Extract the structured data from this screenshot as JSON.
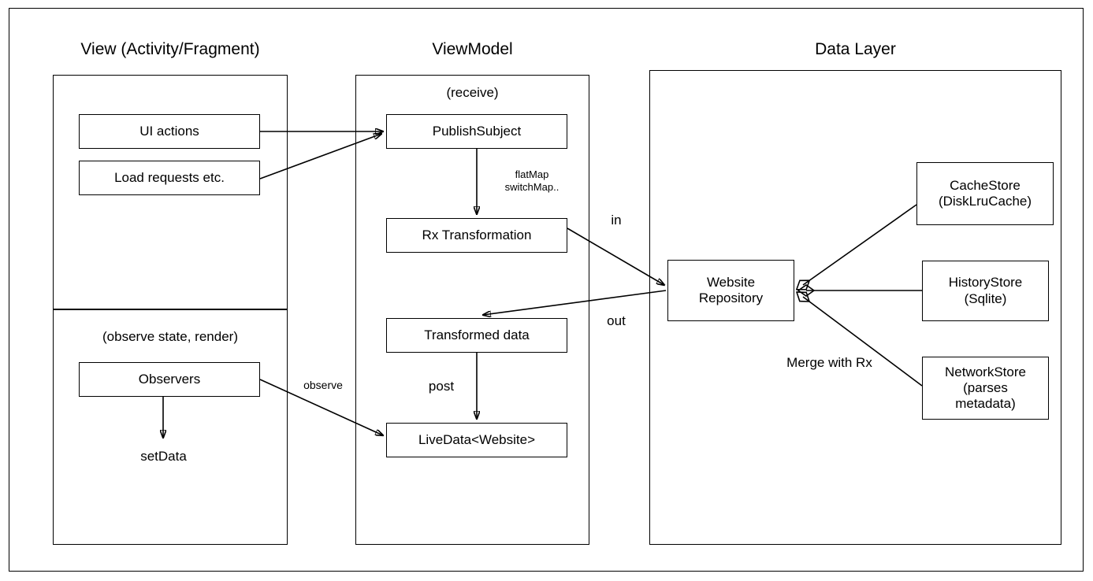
{
  "diagram": {
    "title_view": "View (Activity/Fragment)",
    "title_viewmodel": "ViewModel",
    "title_datalayer": "Data Layer"
  },
  "view_column": {
    "upper": {
      "nodes": [
        {
          "label": "UI actions"
        },
        {
          "label": "Load requests etc."
        }
      ]
    },
    "lower": {
      "caption": "(observe state, render)",
      "nodes": [
        {
          "label": "Observers"
        }
      ],
      "terminal_label": "setData"
    }
  },
  "viewmodel_column": {
    "caption": "(receive)",
    "nodes": [
      {
        "label": "PublishSubject"
      },
      {
        "label": "Rx Transformation"
      },
      {
        "label": "Transformed data"
      },
      {
        "label": "LiveData<Website>"
      }
    ],
    "edge_labels": {
      "transform": "flatMap\nswitchMap..",
      "post": "post"
    }
  },
  "data_layer_column": {
    "repository": {
      "label": "Website\nRepository"
    },
    "stores": [
      {
        "label": "CacheStore\n(DiskLruCache)"
      },
      {
        "label": "HistoryStore\n(Sqlite)"
      },
      {
        "label": "NetworkStore\n(parses\nmetadata)"
      }
    ],
    "merge_label": "Merge with Rx"
  },
  "cross_labels": {
    "observe": "observe",
    "in": "in",
    "out": "out"
  },
  "colors": {
    "stroke": "#000000",
    "background": "#ffffff",
    "text": "#000000"
  }
}
